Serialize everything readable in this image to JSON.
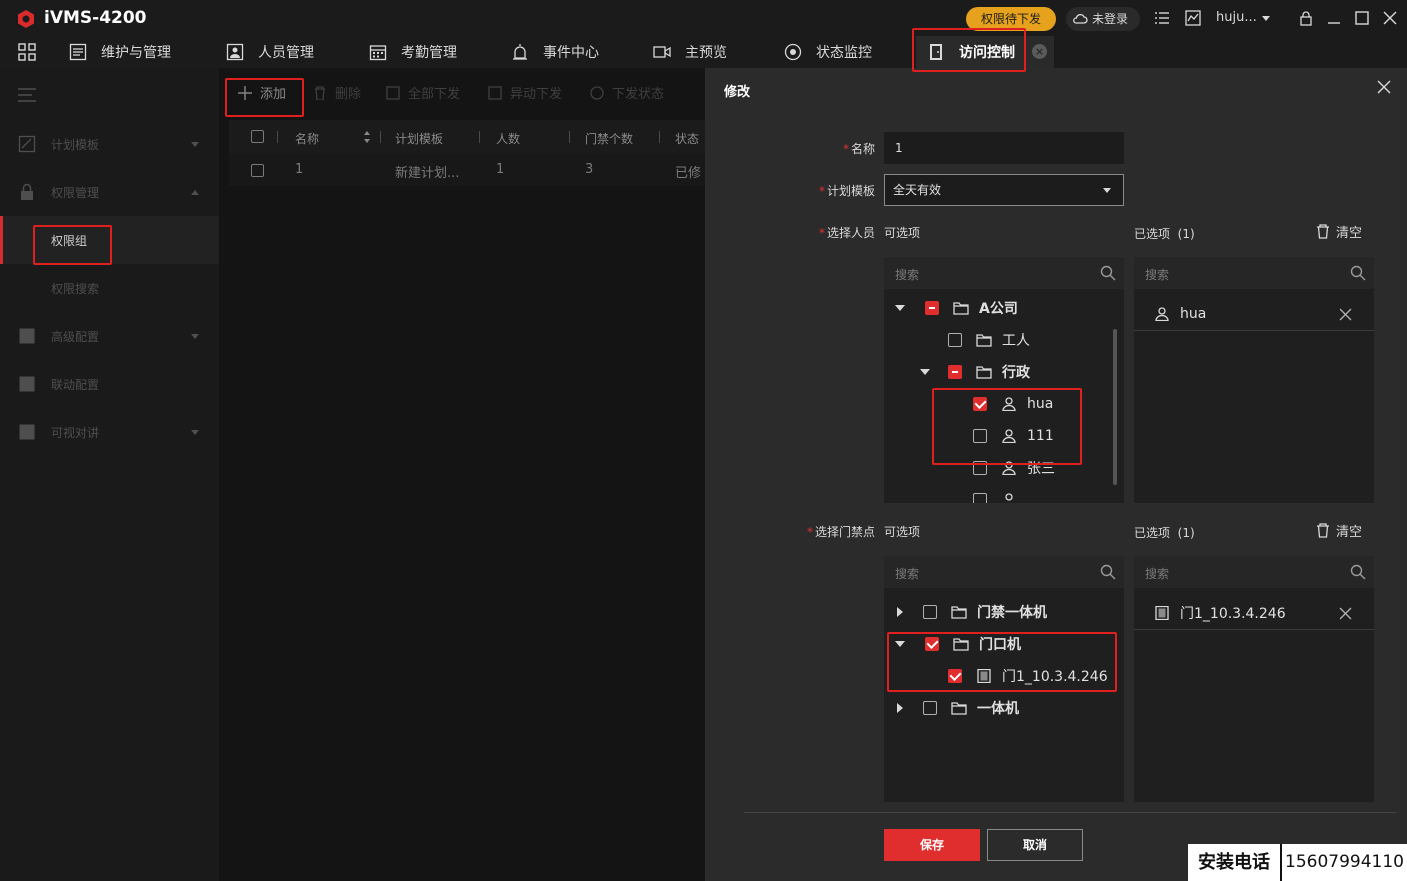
{
  "app": {
    "title": "iVMS-4200",
    "brand_color": "#d82b2b"
  },
  "titlebar": {
    "pending_label": "权限待下发",
    "login_label": "未登录",
    "user": "huju..."
  },
  "tabs": [
    {
      "label": "维护与管理"
    },
    {
      "label": "人员管理"
    },
    {
      "label": "考勤管理"
    },
    {
      "label": "事件中心"
    },
    {
      "label": "主预览"
    },
    {
      "label": "状态监控"
    },
    {
      "label": "访问控制"
    }
  ],
  "sidebar": {
    "items": [
      {
        "label": "计划模板"
      },
      {
        "label": "权限管理"
      },
      {
        "label": "权限组"
      },
      {
        "label": "权限搜索"
      },
      {
        "label": "高级配置"
      },
      {
        "label": "联动配置"
      },
      {
        "label": "可视对讲"
      }
    ]
  },
  "toolbar": {
    "add": "添加",
    "delete": "删除",
    "send_all": "全部下发",
    "send_diff": "异动下发",
    "send_status": "下发状态"
  },
  "table": {
    "columns": [
      "名称",
      "计划模板",
      "人数",
      "门禁个数",
      "状态"
    ],
    "rows": [
      {
        "name": "1",
        "template": "新建计划...",
        "people": "1",
        "doors": "3",
        "status": "已修"
      }
    ]
  },
  "panel": {
    "title": "修改",
    "name_label": "名称",
    "name_value": "1",
    "template_label": "计划模板",
    "template_value": "全天有效",
    "people_label": "选择人员",
    "doors_label": "选择门禁点",
    "available_label": "可选项",
    "selected_label": "已选项",
    "people_selected_count": "(1)",
    "doors_selected_count": "(1)",
    "clear_label": "清空",
    "search_placeholder": "搜索",
    "people_tree": [
      {
        "label": "A公司"
      },
      {
        "label": "工人"
      },
      {
        "label": "行政"
      },
      {
        "label": "hua"
      },
      {
        "label": "111"
      },
      {
        "label": "张三"
      }
    ],
    "people_selected": [
      {
        "label": "hua"
      }
    ],
    "door_tree": [
      {
        "label": "门禁一体机"
      },
      {
        "label": "门口机"
      },
      {
        "label": "门1_10.3.4.246"
      },
      {
        "label": "一体机"
      }
    ],
    "doors_selected": [
      {
        "label": "门1_10.3.4.246"
      }
    ],
    "save": "保存",
    "cancel": "取消"
  },
  "watermark": {
    "label": "安装电话",
    "number": "15607994110"
  }
}
